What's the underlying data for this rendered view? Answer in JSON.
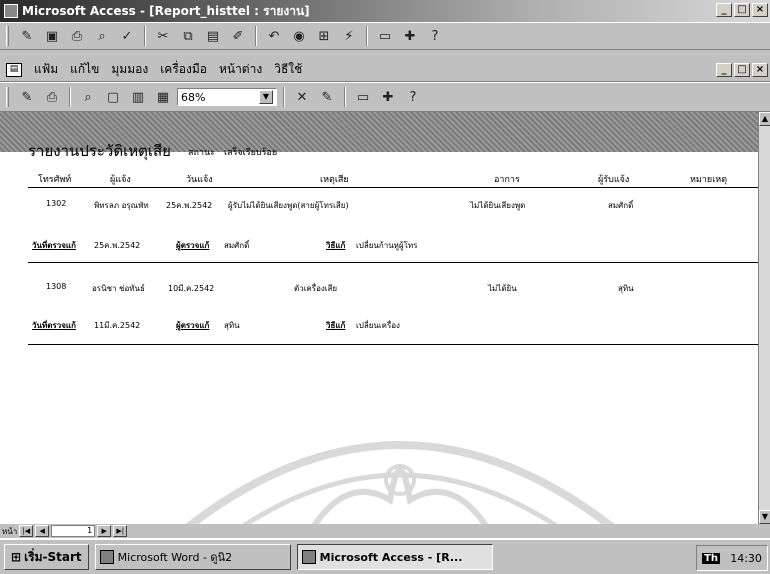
{
  "window": {
    "title": "Microsoft Access - [Report_histtel : รายงาน]",
    "controls": [
      "_",
      "□",
      "×"
    ]
  },
  "menubar": {
    "items": [
      "แฟ้ม",
      "แก้ไข",
      "มุมมอง",
      "เครื่องมือ",
      "หน้าต่าง",
      "วิธีใช้"
    ]
  },
  "preview_toolbar": {
    "zoom": "68%"
  },
  "report": {
    "title": "รายงานประวัติเหตุเสีย",
    "status_label": "สถานะ",
    "status_value": "เสร็จเรียบร้อย",
    "columns": [
      "โทรศัพท์",
      "ผู้แจ้ง",
      "วันแจ้ง",
      "เหตุเสีย",
      "อาการ",
      "ผู้รับแจ้ง",
      "หมายเหตุ"
    ],
    "records": [
      {
        "phone": "1302",
        "reporter": "พิทรลภ อรุณพัท",
        "date": "25ค.พ.2542",
        "fault": "ผู้รับไม่ได้ยินเสียงพูด(สายผู้โทรเสีย)",
        "symptom": "ไม่ได้ยินเสียงพูด",
        "receiver": "สมศักดิ์",
        "check_date_label": "วันที่ตรวจแก้",
        "check_date": "25ค.พ.2542",
        "checker_label": "ผู้ตรวจแก้",
        "checker": "สมศักดิ์",
        "method_label": "วิธีแก้",
        "method": "เปลี่ยนก้านหูผู้โทร"
      },
      {
        "phone": "1308",
        "reporter": "อรนิชา ช่อทันธ์",
        "date": "10มี.ค.2542",
        "fault": "ตัวเครื่องเสีย",
        "symptom": "ไม่ได้ยิน",
        "receiver": "สุทิน",
        "check_date_label": "วันที่ตรวจแก้",
        "check_date": "11มี.ค.2542",
        "checker_label": "ผู้ตรวจแก้",
        "checker": "สุทิน",
        "method_label": "วิธีแก้",
        "method": "เปลี่ยนเครื่อง"
      }
    ]
  },
  "navigation": {
    "page_label": "หน้า",
    "page_number": "1"
  },
  "taskbar": {
    "start_label": "เริ่ม-Start",
    "tasks": [
      "Microsoft Word - ดูนิ2",
      "Microsoft Access - [R..."
    ],
    "tray_lang": "Th",
    "clock": "14:30"
  },
  "colors": {
    "title_bar": "#2a2a2a",
    "chrome": "#c0c0c0",
    "page": "#ffffff"
  }
}
